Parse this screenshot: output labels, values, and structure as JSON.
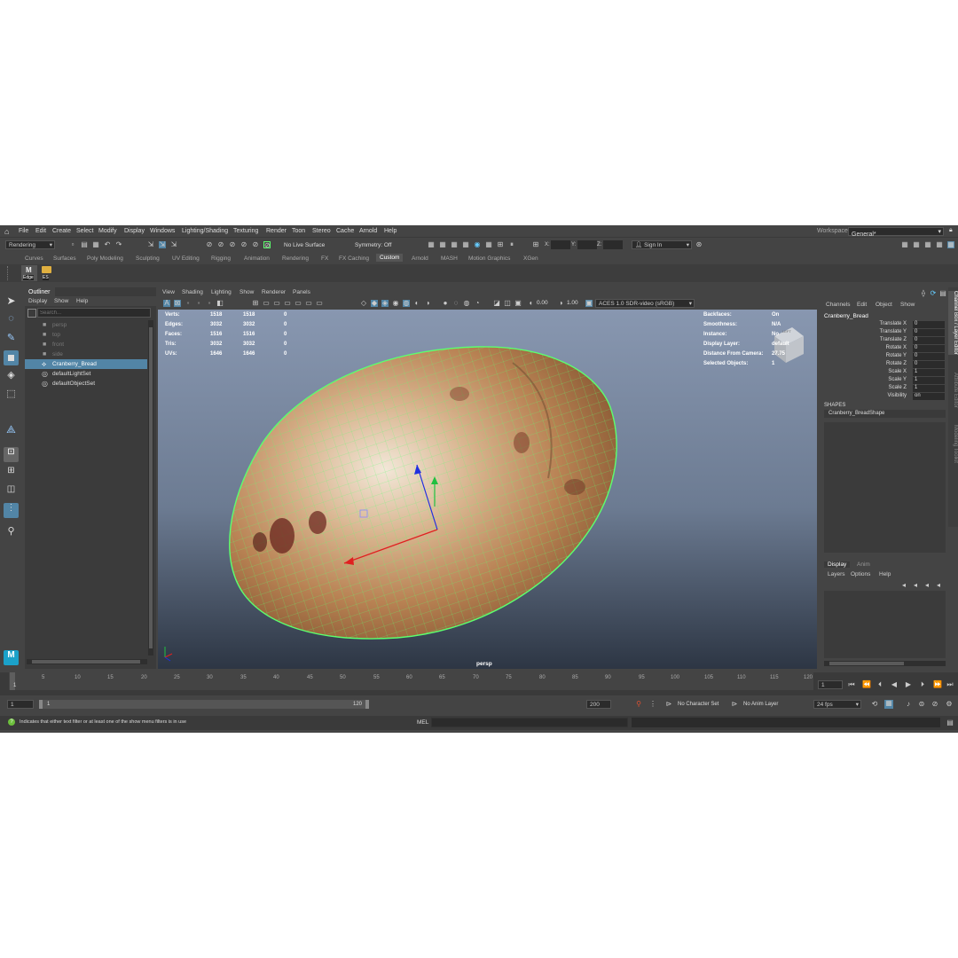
{
  "menus": [
    "File",
    "Edit",
    "Create",
    "Select",
    "Modify",
    "Display",
    "Windows",
    "Lighting/Shading",
    "Texturing",
    "Render",
    "Toon",
    "Stereo",
    "Cache",
    "Arnold",
    "Help"
  ],
  "workspace": {
    "label": "Workspace :",
    "value": "General*"
  },
  "status_line": {
    "mode": "Rendering",
    "live_surface": "No Live Surface",
    "symmetry": "Symmetry: Off",
    "x_label": "X:",
    "y_label": "Y:",
    "z_label": "Z:",
    "sign_in": "Sign In"
  },
  "shelf_tabs": [
    "Curves",
    "Surfaces",
    "Poly Modeling",
    "Sculpting",
    "UV Editing",
    "Rigging",
    "Animation",
    "Rendering",
    "FX",
    "FX Caching",
    "Custom",
    "Arnold",
    "MASH",
    "Motion Graphics",
    "XGen"
  ],
  "active_shelf": "Custom",
  "shelf_buttons": [
    {
      "icon": "M",
      "label": "Edge"
    },
    {
      "icon": "folder",
      "label": "ES"
    }
  ],
  "outliner": {
    "title": "Outliner",
    "menus": [
      "Display",
      "Show",
      "Help"
    ],
    "search_placeholder": "Search...",
    "items": [
      {
        "label": "persp",
        "type": "camera",
        "dim": true
      },
      {
        "label": "top",
        "type": "camera",
        "dim": true
      },
      {
        "label": "front",
        "type": "camera",
        "dim": true
      },
      {
        "label": "side",
        "type": "camera",
        "dim": true
      },
      {
        "label": "Cranberry_Bread",
        "type": "mesh",
        "selected": true
      },
      {
        "label": "defaultLightSet",
        "type": "set"
      },
      {
        "label": "defaultObjectSet",
        "type": "set"
      }
    ]
  },
  "viewport": {
    "menus": [
      "View",
      "Shading",
      "Lighting",
      "Show",
      "Renderer",
      "Panels"
    ],
    "exposure": "0.00",
    "gamma": "1.00",
    "color_space": "ACES 1.0 SDR-video (sRGB)",
    "camera_label": "persp",
    "hud_left": [
      {
        "label": "Verts:",
        "a": "1518",
        "b": "1518",
        "c": "0"
      },
      {
        "label": "Edges:",
        "a": "3032",
        "b": "3032",
        "c": "0"
      },
      {
        "label": "Faces:",
        "a": "1516",
        "b": "1516",
        "c": "0"
      },
      {
        "label": "Tris:",
        "a": "3032",
        "b": "3032",
        "c": "0"
      },
      {
        "label": "UVs:",
        "a": "1646",
        "b": "1646",
        "c": "0"
      }
    ],
    "hud_right": [
      {
        "label": "Backfaces:",
        "value": "On"
      },
      {
        "label": "Smoothness:",
        "value": "N/A"
      },
      {
        "label": "Instance:",
        "value": "No"
      },
      {
        "label": "Display Layer:",
        "value": "default"
      },
      {
        "label": "Distance From Camera:",
        "value": "27.75"
      },
      {
        "label": "Selected Objects:",
        "value": "1"
      }
    ],
    "view_cube_label": "LEFT"
  },
  "channel_box": {
    "menus": [
      "Channels",
      "Edit",
      "Object",
      "Show"
    ],
    "object_name": "Cranberry_Bread",
    "channels": [
      {
        "label": "Translate X",
        "value": "0"
      },
      {
        "label": "Translate Y",
        "value": "0"
      },
      {
        "label": "Translate Z",
        "value": "0"
      },
      {
        "label": "Rotate X",
        "value": "0"
      },
      {
        "label": "Rotate Y",
        "value": "0"
      },
      {
        "label": "Rotate Z",
        "value": "0"
      },
      {
        "label": "Scale X",
        "value": "1"
      },
      {
        "label": "Scale Y",
        "value": "1"
      },
      {
        "label": "Scale Z",
        "value": "1"
      },
      {
        "label": "Visibility",
        "value": "on"
      }
    ],
    "shapes_header": "SHAPES",
    "shape_name": "Cranberry_BreadShape"
  },
  "side_tabs": [
    "Channel Box / Layer Editor",
    "Attribute Editor",
    "Modeling Toolkit"
  ],
  "layer_editor": {
    "tabs": [
      "Display",
      "Anim"
    ],
    "menus": [
      "Layers",
      "Options",
      "Help"
    ]
  },
  "timeline": {
    "ticks": [
      "1",
      "5",
      "10",
      "15",
      "20",
      "25",
      "30",
      "35",
      "40",
      "45",
      "50",
      "55",
      "60",
      "65",
      "70",
      "75",
      "80",
      "85",
      "90",
      "95",
      "100",
      "105",
      "110",
      "115",
      "120"
    ],
    "current_frame": "1"
  },
  "range": {
    "start": "1",
    "inner_start": "1",
    "inner_end": "120",
    "end": "200",
    "character_set": "No Character Set",
    "anim_layer": "No Anim Layer",
    "fps": "24 fps"
  },
  "status_bar": {
    "message": "Indicates that either text filter or at least one of the show menu filters is in use",
    "mel_label": "MEL"
  },
  "colors": {
    "selection": "#5285a6",
    "wireframe": "#5cff6e",
    "bg_top": "#8897b0",
    "bg_bottom": "#2d3644"
  }
}
